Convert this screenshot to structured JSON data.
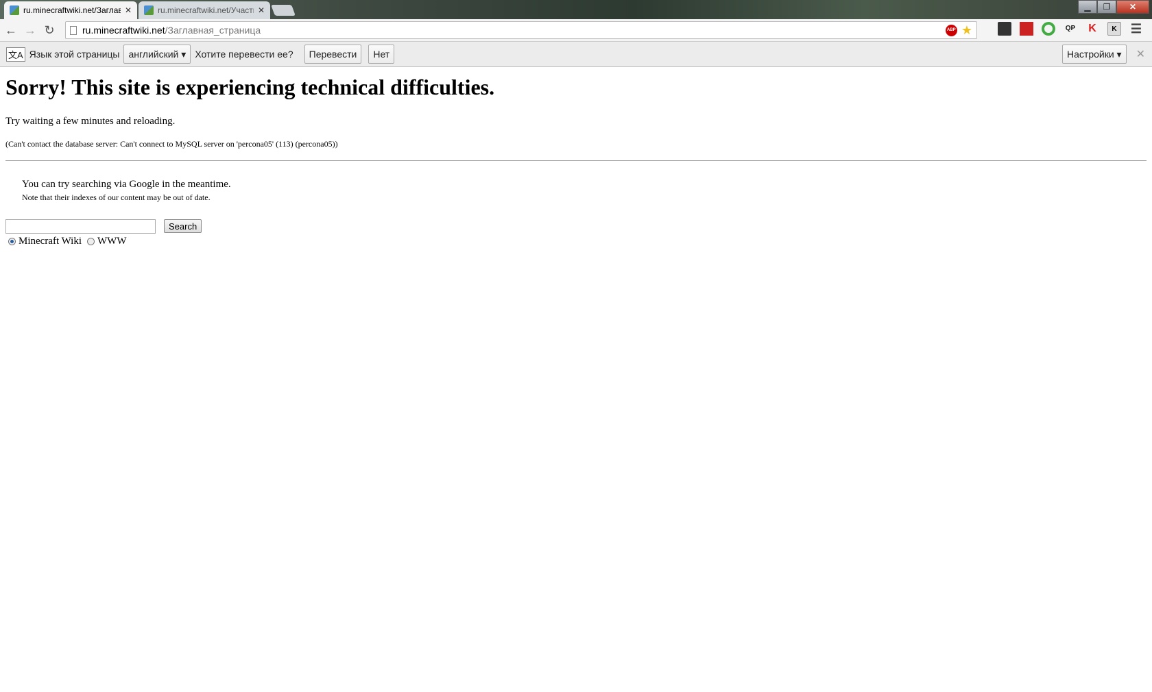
{
  "browser": {
    "tabs": [
      {
        "title": "ru.minecraftwiki.net/Заглавная_страница",
        "active": true
      },
      {
        "title": "ru.minecraftwiki.net/Участник",
        "active": false
      }
    ],
    "url": {
      "host": "ru.minecraftwiki.net",
      "path": "/Заглавная_страница"
    },
    "extensions": [
      "adblock-plus-icon",
      "bookmark-star-icon",
      "extension-thumbnail-icon",
      "pdf-icon",
      "refresh-extension-icon",
      "qp-icon",
      "kaspersky-icon",
      "k-icon",
      "menu-icon"
    ],
    "abp_label": "ABP"
  },
  "translate_bar": {
    "label": "Язык этой страницы",
    "language": "английский",
    "question": "Хотите перевести ее?",
    "translate": "Перевести",
    "no": "Нет",
    "settings": "Настройки"
  },
  "page": {
    "heading": "Sorry! This site is experiencing technical difficulties.",
    "retry": "Try waiting a few minutes and reloading.",
    "error": "(Can't contact the database server: Can't connect to MySQL server on 'percona05' (113) (percona05))",
    "google_line": "You can try searching via Google in the meantime.",
    "note": "Note that their indexes of our content may be out of date.",
    "search_value": "",
    "search_button": "Search",
    "radio_options": [
      {
        "label": "Minecraft Wiki",
        "checked": true
      },
      {
        "label": "WWW",
        "checked": false
      }
    ]
  }
}
